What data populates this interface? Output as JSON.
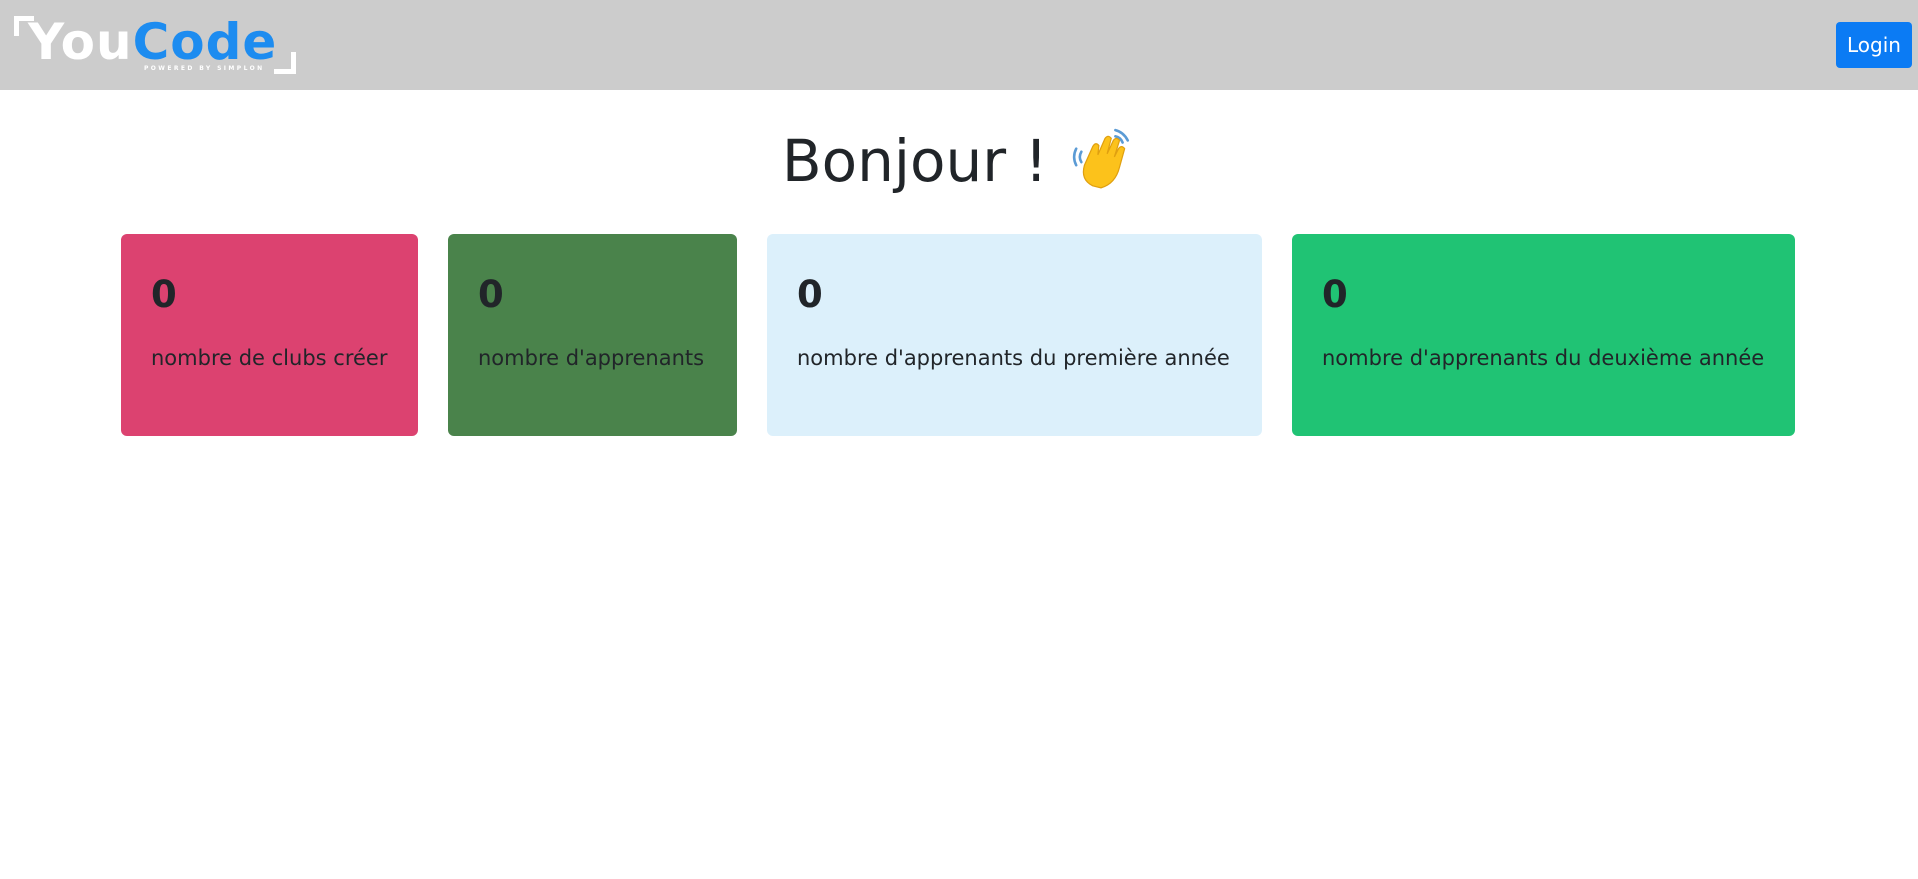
{
  "header": {
    "logo": {
      "part1": "You",
      "part2": "Code",
      "tagline": "POWERED BY SIMPLON"
    },
    "login_label": "Login"
  },
  "main": {
    "greeting": "Bonjour !",
    "greeting_icon": "waving-hand-icon",
    "stats": [
      {
        "value": "0",
        "label": "nombre de clubs créer",
        "color": "#dc4270"
      },
      {
        "value": "0",
        "label": "nombre d'apprenants",
        "color": "#4a834b"
      },
      {
        "value": "0",
        "label": "nombre d'apprenants du première année",
        "color": "#dcf0fb"
      },
      {
        "value": "0",
        "label": "nombre d'apprenants du deuxième année",
        "color": "#20c374"
      }
    ]
  },
  "colors": {
    "navbar": "#cccccc",
    "accent": "#0b7bf4",
    "brand_blue": "#1d8cf0"
  }
}
